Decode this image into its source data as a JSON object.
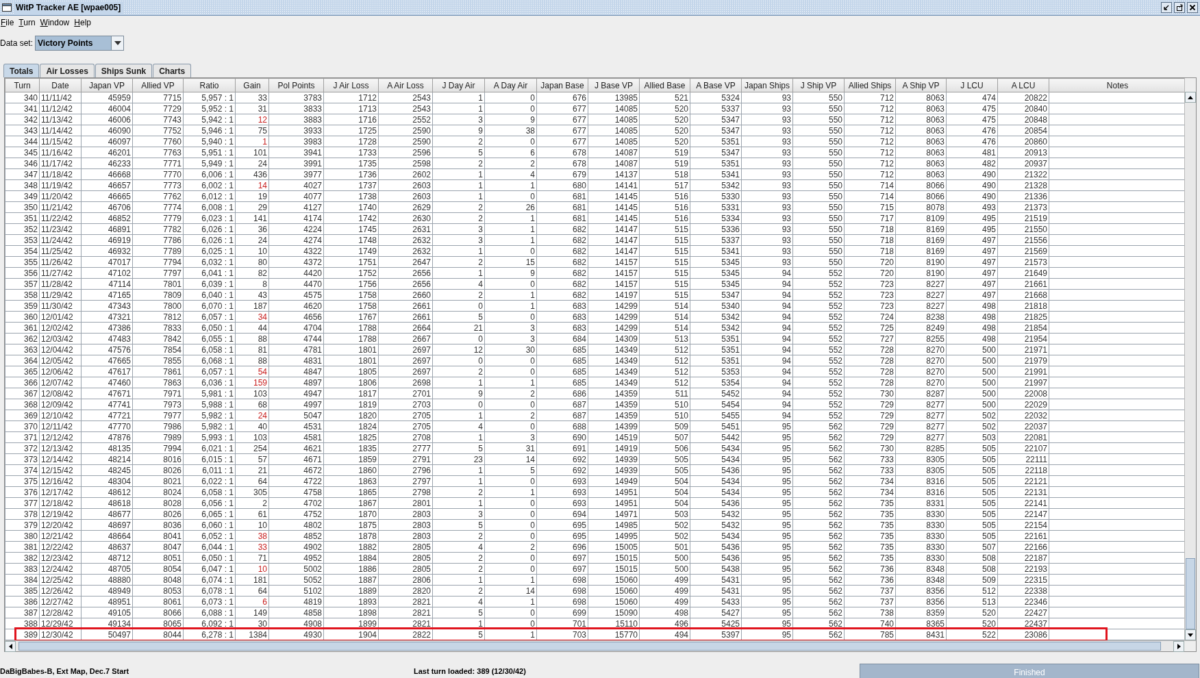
{
  "window": {
    "title": "WitP Tracker AE [wpae005]"
  },
  "menu": [
    "File",
    "Turn",
    "Window",
    "Help"
  ],
  "data_set": {
    "label": "Data set:",
    "value": "Victory Points"
  },
  "tabs": [
    {
      "label": "Totals",
      "selected": true
    },
    {
      "label": "Air Losses",
      "selected": false
    },
    {
      "label": "Ships Sunk",
      "selected": false
    },
    {
      "label": "Charts",
      "selected": false
    }
  ],
  "table": {
    "columns": [
      "Turn",
      "Date",
      "Japan VP",
      "Allied VP",
      "Ratio",
      "Gain",
      "Pol Points",
      "J Air Loss",
      "A Air Loss",
      "J Day Air",
      "A Day Air",
      "Japan Base",
      "J Base VP",
      "Allied Base",
      "A Base VP",
      "Japan Ships",
      "J Ship VP",
      "Allied Ships",
      "A Ship VP",
      "J LCU",
      "A LCU",
      "Notes"
    ],
    "rows": [
      {
        "cells": [
          "340",
          "11/11/42",
          "45959",
          "7715",
          "5,957 : 1",
          "33",
          "3783",
          "1712",
          "2543",
          "1",
          "0",
          "676",
          "13985",
          "521",
          "5324",
          "93",
          "550",
          "712",
          "8063",
          "474",
          "20822"
        ],
        "gain_alert": false,
        "marked": false
      },
      {
        "cells": [
          "341",
          "11/12/42",
          "46004",
          "7729",
          "5,952 : 1",
          "31",
          "3833",
          "1713",
          "2543",
          "1",
          "0",
          "677",
          "14085",
          "520",
          "5337",
          "93",
          "550",
          "712",
          "8063",
          "475",
          "20840"
        ],
        "gain_alert": false,
        "marked": false
      },
      {
        "cells": [
          "342",
          "11/13/42",
          "46006",
          "7743",
          "5,942 : 1",
          "12",
          "3883",
          "1716",
          "2552",
          "3",
          "9",
          "677",
          "14085",
          "520",
          "5347",
          "93",
          "550",
          "712",
          "8063",
          "475",
          "20848"
        ],
        "gain_alert": true,
        "marked": false
      },
      {
        "cells": [
          "343",
          "11/14/42",
          "46090",
          "7752",
          "5,946 : 1",
          "75",
          "3933",
          "1725",
          "2590",
          "9",
          "38",
          "677",
          "14085",
          "520",
          "5347",
          "93",
          "550",
          "712",
          "8063",
          "476",
          "20854"
        ],
        "gain_alert": false,
        "marked": false
      },
      {
        "cells": [
          "344",
          "11/15/42",
          "46097",
          "7760",
          "5,940 : 1",
          "1",
          "3983",
          "1728",
          "2590",
          "2",
          "0",
          "677",
          "14085",
          "520",
          "5351",
          "93",
          "550",
          "712",
          "8063",
          "476",
          "20860"
        ],
        "gain_alert": true,
        "marked": false
      },
      {
        "cells": [
          "345",
          "11/16/42",
          "46201",
          "7763",
          "5,951 : 1",
          "101",
          "3941",
          "1733",
          "2596",
          "5",
          "6",
          "678",
          "14087",
          "519",
          "5347",
          "93",
          "550",
          "712",
          "8063",
          "481",
          "20913"
        ],
        "gain_alert": false,
        "marked": false
      },
      {
        "cells": [
          "346",
          "11/17/42",
          "46233",
          "7771",
          "5,949 : 1",
          "24",
          "3991",
          "1735",
          "2598",
          "2",
          "2",
          "678",
          "14087",
          "519",
          "5351",
          "93",
          "550",
          "712",
          "8063",
          "482",
          "20937"
        ],
        "gain_alert": false,
        "marked": false
      },
      {
        "cells": [
          "347",
          "11/18/42",
          "46668",
          "7770",
          "6,006 : 1",
          "436",
          "3977",
          "1736",
          "2602",
          "1",
          "4",
          "679",
          "14137",
          "518",
          "5341",
          "93",
          "550",
          "712",
          "8063",
          "490",
          "21322"
        ],
        "gain_alert": false,
        "marked": false
      },
      {
        "cells": [
          "348",
          "11/19/42",
          "46657",
          "7773",
          "6,002 : 1",
          "14",
          "4027",
          "1737",
          "2603",
          "1",
          "1",
          "680",
          "14141",
          "517",
          "5342",
          "93",
          "550",
          "714",
          "8066",
          "490",
          "21328"
        ],
        "gain_alert": true,
        "marked": false
      },
      {
        "cells": [
          "349",
          "11/20/42",
          "46665",
          "7762",
          "6,012 : 1",
          "19",
          "4077",
          "1738",
          "2603",
          "1",
          "0",
          "681",
          "14145",
          "516",
          "5330",
          "93",
          "550",
          "714",
          "8066",
          "490",
          "21336"
        ],
        "gain_alert": false,
        "marked": false
      },
      {
        "cells": [
          "350",
          "11/21/42",
          "46706",
          "7774",
          "6,008 : 1",
          "29",
          "4127",
          "1740",
          "2629",
          "2",
          "26",
          "681",
          "14145",
          "516",
          "5331",
          "93",
          "550",
          "715",
          "8078",
          "493",
          "21373"
        ],
        "gain_alert": false,
        "marked": false
      },
      {
        "cells": [
          "351",
          "11/22/42",
          "46852",
          "7779",
          "6,023 : 1",
          "141",
          "4174",
          "1742",
          "2630",
          "2",
          "1",
          "681",
          "14145",
          "516",
          "5334",
          "93",
          "550",
          "717",
          "8109",
          "495",
          "21519"
        ],
        "gain_alert": false,
        "marked": false
      },
      {
        "cells": [
          "352",
          "11/23/42",
          "46891",
          "7782",
          "6,026 : 1",
          "36",
          "4224",
          "1745",
          "2631",
          "3",
          "1",
          "682",
          "14147",
          "515",
          "5336",
          "93",
          "550",
          "718",
          "8169",
          "495",
          "21550"
        ],
        "gain_alert": false,
        "marked": false
      },
      {
        "cells": [
          "353",
          "11/24/42",
          "46919",
          "7786",
          "6,026 : 1",
          "24",
          "4274",
          "1748",
          "2632",
          "3",
          "1",
          "682",
          "14147",
          "515",
          "5337",
          "93",
          "550",
          "718",
          "8169",
          "497",
          "21556"
        ],
        "gain_alert": false,
        "marked": false
      },
      {
        "cells": [
          "354",
          "11/25/42",
          "46932",
          "7789",
          "6,025 : 1",
          "10",
          "4322",
          "1749",
          "2632",
          "1",
          "0",
          "682",
          "14147",
          "515",
          "5341",
          "93",
          "550",
          "718",
          "8169",
          "497",
          "21569"
        ],
        "gain_alert": false,
        "marked": false
      },
      {
        "cells": [
          "355",
          "11/26/42",
          "47017",
          "7794",
          "6,032 : 1",
          "80",
          "4372",
          "1751",
          "2647",
          "2",
          "15",
          "682",
          "14157",
          "515",
          "5345",
          "93",
          "550",
          "720",
          "8190",
          "497",
          "21573"
        ],
        "gain_alert": false,
        "marked": false
      },
      {
        "cells": [
          "356",
          "11/27/42",
          "47102",
          "7797",
          "6,041 : 1",
          "82",
          "4420",
          "1752",
          "2656",
          "1",
          "9",
          "682",
          "14157",
          "515",
          "5345",
          "94",
          "552",
          "720",
          "8190",
          "497",
          "21649"
        ],
        "gain_alert": false,
        "marked": false
      },
      {
        "cells": [
          "357",
          "11/28/42",
          "47114",
          "7801",
          "6,039 : 1",
          "8",
          "4470",
          "1756",
          "2656",
          "4",
          "0",
          "682",
          "14157",
          "515",
          "5345",
          "94",
          "552",
          "723",
          "8227",
          "497",
          "21661"
        ],
        "gain_alert": false,
        "marked": false
      },
      {
        "cells": [
          "358",
          "11/29/42",
          "47165",
          "7809",
          "6,040 : 1",
          "43",
          "4575",
          "1758",
          "2660",
          "2",
          "1",
          "682",
          "14197",
          "515",
          "5347",
          "94",
          "552",
          "723",
          "8227",
          "497",
          "21668"
        ],
        "gain_alert": false,
        "marked": false
      },
      {
        "cells": [
          "359",
          "11/30/42",
          "47343",
          "7800",
          "6,070 : 1",
          "187",
          "4620",
          "1758",
          "2661",
          "0",
          "1",
          "683",
          "14299",
          "514",
          "5340",
          "94",
          "552",
          "723",
          "8227",
          "498",
          "21818"
        ],
        "gain_alert": false,
        "marked": false
      },
      {
        "cells": [
          "360",
          "12/01/42",
          "47321",
          "7812",
          "6,057 : 1",
          "34",
          "4656",
          "1767",
          "2661",
          "5",
          "0",
          "683",
          "14299",
          "514",
          "5342",
          "94",
          "552",
          "724",
          "8238",
          "498",
          "21825"
        ],
        "gain_alert": true,
        "marked": false
      },
      {
        "cells": [
          "361",
          "12/02/42",
          "47386",
          "7833",
          "6,050 : 1",
          "44",
          "4704",
          "1788",
          "2664",
          "21",
          "3",
          "683",
          "14299",
          "514",
          "5342",
          "94",
          "552",
          "725",
          "8249",
          "498",
          "21854"
        ],
        "gain_alert": false,
        "marked": false
      },
      {
        "cells": [
          "362",
          "12/03/42",
          "47483",
          "7842",
          "6,055 : 1",
          "88",
          "4744",
          "1788",
          "2667",
          "0",
          "3",
          "684",
          "14309",
          "513",
          "5351",
          "94",
          "552",
          "727",
          "8255",
          "498",
          "21954"
        ],
        "gain_alert": false,
        "marked": false
      },
      {
        "cells": [
          "363",
          "12/04/42",
          "47576",
          "7854",
          "6,058 : 1",
          "81",
          "4781",
          "1801",
          "2697",
          "12",
          "30",
          "685",
          "14349",
          "512",
          "5351",
          "94",
          "552",
          "728",
          "8270",
          "500",
          "21971"
        ],
        "gain_alert": false,
        "marked": false
      },
      {
        "cells": [
          "364",
          "12/05/42",
          "47665",
          "7855",
          "6,068 : 1",
          "88",
          "4831",
          "1801",
          "2697",
          "0",
          "0",
          "685",
          "14349",
          "512",
          "5351",
          "94",
          "552",
          "728",
          "8270",
          "500",
          "21979"
        ],
        "gain_alert": false,
        "marked": false
      },
      {
        "cells": [
          "365",
          "12/06/42",
          "47617",
          "7861",
          "6,057 : 1",
          "54",
          "4847",
          "1805",
          "2697",
          "2",
          "0",
          "685",
          "14349",
          "512",
          "5353",
          "94",
          "552",
          "728",
          "8270",
          "500",
          "21991"
        ],
        "gain_alert": true,
        "marked": false
      },
      {
        "cells": [
          "366",
          "12/07/42",
          "47460",
          "7863",
          "6,036 : 1",
          "159",
          "4897",
          "1806",
          "2698",
          "1",
          "1",
          "685",
          "14349",
          "512",
          "5354",
          "94",
          "552",
          "728",
          "8270",
          "500",
          "21997"
        ],
        "gain_alert": true,
        "marked": false
      },
      {
        "cells": [
          "367",
          "12/08/42",
          "47671",
          "7971",
          "5,981 : 1",
          "103",
          "4947",
          "1817",
          "2701",
          "9",
          "2",
          "686",
          "14359",
          "511",
          "5452",
          "94",
          "552",
          "730",
          "8287",
          "500",
          "22008"
        ],
        "gain_alert": false,
        "marked": false
      },
      {
        "cells": [
          "368",
          "12/09/42",
          "47741",
          "7973",
          "5,988 : 1",
          "68",
          "4997",
          "1819",
          "2703",
          "0",
          "0",
          "687",
          "14359",
          "510",
          "5454",
          "94",
          "552",
          "729",
          "8277",
          "500",
          "22029"
        ],
        "gain_alert": false,
        "marked": false
      },
      {
        "cells": [
          "369",
          "12/10/42",
          "47721",
          "7977",
          "5,982 : 1",
          "24",
          "5047",
          "1820",
          "2705",
          "1",
          "2",
          "687",
          "14359",
          "510",
          "5455",
          "94",
          "552",
          "729",
          "8277",
          "502",
          "22032"
        ],
        "gain_alert": true,
        "marked": false
      },
      {
        "cells": [
          "370",
          "12/11/42",
          "47770",
          "7986",
          "5,982 : 1",
          "40",
          "4531",
          "1824",
          "2705",
          "4",
          "0",
          "688",
          "14399",
          "509",
          "5451",
          "95",
          "562",
          "729",
          "8277",
          "502",
          "22037"
        ],
        "gain_alert": false,
        "marked": false
      },
      {
        "cells": [
          "371",
          "12/12/42",
          "47876",
          "7989",
          "5,993 : 1",
          "103",
          "4581",
          "1825",
          "2708",
          "1",
          "3",
          "690",
          "14519",
          "507",
          "5442",
          "95",
          "562",
          "729",
          "8277",
          "503",
          "22081"
        ],
        "gain_alert": false,
        "marked": false
      },
      {
        "cells": [
          "372",
          "12/13/42",
          "48135",
          "7994",
          "6,021 : 1",
          "254",
          "4621",
          "1835",
          "2777",
          "5",
          "31",
          "691",
          "14919",
          "506",
          "5434",
          "95",
          "562",
          "730",
          "8285",
          "505",
          "22107"
        ],
        "gain_alert": false,
        "marked": false
      },
      {
        "cells": [
          "373",
          "12/14/42",
          "48214",
          "8016",
          "6,015 : 1",
          "57",
          "4671",
          "1859",
          "2791",
          "23",
          "14",
          "692",
          "14939",
          "505",
          "5434",
          "95",
          "562",
          "733",
          "8305",
          "505",
          "22111"
        ],
        "gain_alert": false,
        "marked": false
      },
      {
        "cells": [
          "374",
          "12/15/42",
          "48245",
          "8026",
          "6,011 : 1",
          "21",
          "4672",
          "1860",
          "2796",
          "1",
          "5",
          "692",
          "14939",
          "505",
          "5436",
          "95",
          "562",
          "733",
          "8305",
          "505",
          "22118"
        ],
        "gain_alert": false,
        "marked": false
      },
      {
        "cells": [
          "375",
          "12/16/42",
          "48304",
          "8021",
          "6,022 : 1",
          "64",
          "4722",
          "1863",
          "2797",
          "1",
          "0",
          "693",
          "14949",
          "504",
          "5434",
          "95",
          "562",
          "734",
          "8316",
          "505",
          "22121"
        ],
        "gain_alert": false,
        "marked": false
      },
      {
        "cells": [
          "376",
          "12/17/42",
          "48612",
          "8024",
          "6,058 : 1",
          "305",
          "4758",
          "1865",
          "2798",
          "2",
          "1",
          "693",
          "14951",
          "504",
          "5434",
          "95",
          "562",
          "734",
          "8316",
          "505",
          "22131"
        ],
        "gain_alert": false,
        "marked": false
      },
      {
        "cells": [
          "377",
          "12/18/42",
          "48618",
          "8028",
          "6,056 : 1",
          "2",
          "4702",
          "1867",
          "2801",
          "1",
          "0",
          "693",
          "14951",
          "504",
          "5436",
          "95",
          "562",
          "735",
          "8331",
          "505",
          "22141"
        ],
        "gain_alert": false,
        "marked": false
      },
      {
        "cells": [
          "378",
          "12/19/42",
          "48677",
          "8026",
          "6,065 : 1",
          "61",
          "4752",
          "1870",
          "2803",
          "3",
          "0",
          "694",
          "14971",
          "503",
          "5432",
          "95",
          "562",
          "735",
          "8330",
          "505",
          "22147"
        ],
        "gain_alert": false,
        "marked": false
      },
      {
        "cells": [
          "379",
          "12/20/42",
          "48697",
          "8036",
          "6,060 : 1",
          "10",
          "4802",
          "1875",
          "2803",
          "5",
          "0",
          "695",
          "14985",
          "502",
          "5432",
          "95",
          "562",
          "735",
          "8330",
          "505",
          "22154"
        ],
        "gain_alert": false,
        "marked": false
      },
      {
        "cells": [
          "380",
          "12/21/42",
          "48664",
          "8041",
          "6,052 : 1",
          "38",
          "4852",
          "1878",
          "2803",
          "2",
          "0",
          "695",
          "14995",
          "502",
          "5434",
          "95",
          "562",
          "735",
          "8330",
          "505",
          "22161"
        ],
        "gain_alert": true,
        "marked": false
      },
      {
        "cells": [
          "381",
          "12/22/42",
          "48637",
          "8047",
          "6,044 : 1",
          "33",
          "4902",
          "1882",
          "2805",
          "4",
          "2",
          "696",
          "15005",
          "501",
          "5436",
          "95",
          "562",
          "735",
          "8330",
          "507",
          "22166"
        ],
        "gain_alert": true,
        "marked": false
      },
      {
        "cells": [
          "382",
          "12/23/42",
          "48712",
          "8051",
          "6,050 : 1",
          "71",
          "4952",
          "1884",
          "2805",
          "2",
          "0",
          "697",
          "15015",
          "500",
          "5436",
          "95",
          "562",
          "735",
          "8330",
          "508",
          "22187"
        ],
        "gain_alert": false,
        "marked": false
      },
      {
        "cells": [
          "383",
          "12/24/42",
          "48705",
          "8054",
          "6,047 : 1",
          "10",
          "5002",
          "1886",
          "2805",
          "2",
          "0",
          "697",
          "15015",
          "500",
          "5438",
          "95",
          "562",
          "736",
          "8348",
          "508",
          "22193"
        ],
        "gain_alert": true,
        "marked": false
      },
      {
        "cells": [
          "384",
          "12/25/42",
          "48880",
          "8048",
          "6,074 : 1",
          "181",
          "5052",
          "1887",
          "2806",
          "1",
          "1",
          "698",
          "15060",
          "499",
          "5431",
          "95",
          "562",
          "736",
          "8348",
          "509",
          "22315"
        ],
        "gain_alert": false,
        "marked": false
      },
      {
        "cells": [
          "385",
          "12/26/42",
          "48949",
          "8053",
          "6,078 : 1",
          "64",
          "5102",
          "1889",
          "2820",
          "2",
          "14",
          "698",
          "15060",
          "499",
          "5431",
          "95",
          "562",
          "737",
          "8356",
          "512",
          "22338"
        ],
        "gain_alert": false,
        "marked": false
      },
      {
        "cells": [
          "386",
          "12/27/42",
          "48951",
          "8061",
          "6,073 : 1",
          "6",
          "4819",
          "1893",
          "2821",
          "4",
          "1",
          "698",
          "15060",
          "499",
          "5433",
          "95",
          "562",
          "737",
          "8356",
          "513",
          "22346"
        ],
        "gain_alert": true,
        "marked": false
      },
      {
        "cells": [
          "387",
          "12/28/42",
          "49105",
          "8066",
          "6,088 : 1",
          "149",
          "4858",
          "1898",
          "2821",
          "5",
          "0",
          "699",
          "15090",
          "498",
          "5427",
          "95",
          "562",
          "738",
          "8359",
          "520",
          "22427"
        ],
        "gain_alert": false,
        "marked": false
      },
      {
        "cells": [
          "388",
          "12/29/42",
          "49134",
          "8065",
          "6,092 : 1",
          "30",
          "4908",
          "1899",
          "2821",
          "1",
          "0",
          "701",
          "15110",
          "496",
          "5425",
          "95",
          "562",
          "740",
          "8365",
          "520",
          "22437"
        ],
        "gain_alert": false,
        "marked": false
      },
      {
        "cells": [
          "389",
          "12/30/42",
          "50497",
          "8044",
          "6,278 : 1",
          "1384",
          "4930",
          "1904",
          "2822",
          "5",
          "1",
          "703",
          "15770",
          "494",
          "5397",
          "95",
          "562",
          "785",
          "8431",
          "522",
          "23086"
        ],
        "gain_alert": false,
        "marked": true
      }
    ]
  },
  "status_bar": {
    "game": "DaBigBabes-B, Ext Map, Dec.7 Start",
    "last_turn": "Last turn loaded: 389 (12/30/42)",
    "progress": {
      "label": "Finished",
      "level": 1
    }
  }
}
